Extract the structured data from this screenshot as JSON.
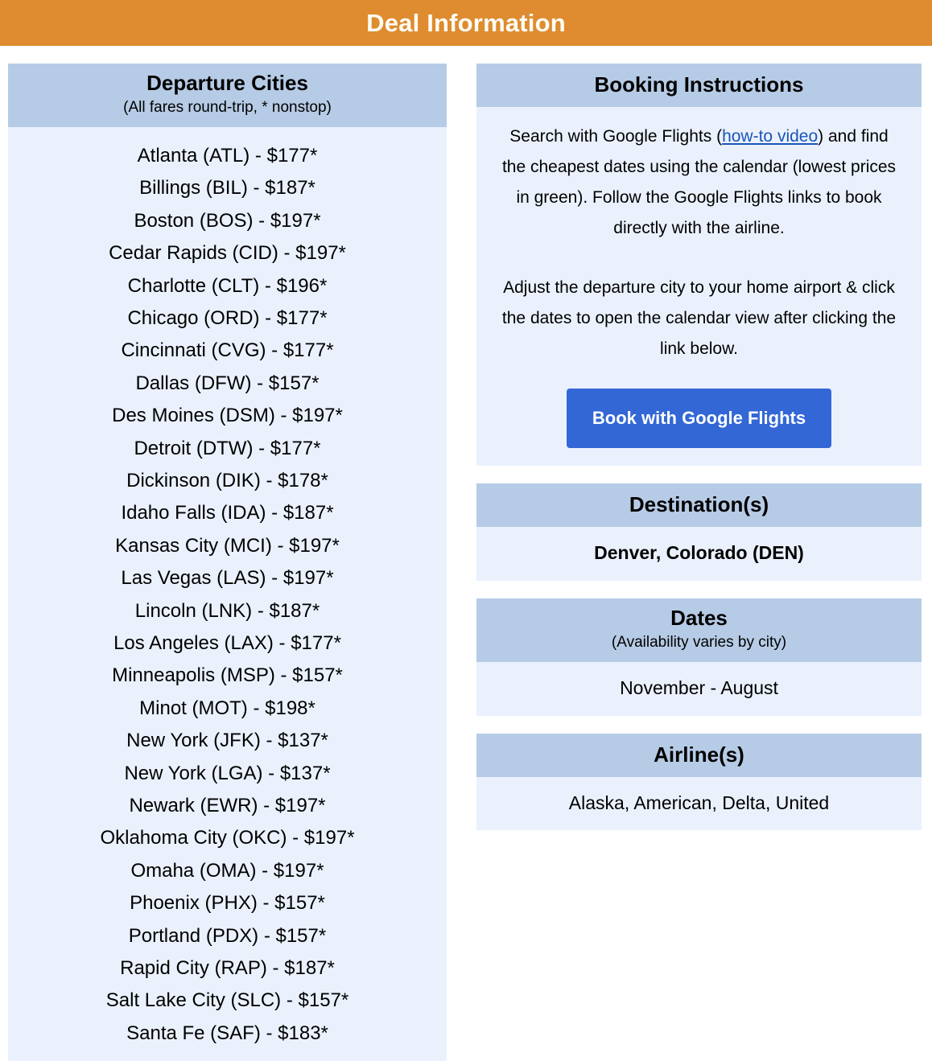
{
  "banner": {
    "title": "Deal Information",
    "background_color": "#de8c2f",
    "text_color": "#fffdf6"
  },
  "theme": {
    "panel_header_bg": "#b6cbe5",
    "panel_body_bg": "#eaf1fd",
    "page_bg": "#ffffff",
    "link_color": "#1a55b8",
    "button_bg": "#3367d6",
    "button_text_color": "#ffffff"
  },
  "departure_cities": {
    "title": "Departure Cities",
    "subtitle": "(All fares round-trip, * nonstop)",
    "rows": [
      "Atlanta (ATL) - $177*",
      "Billings (BIL) - $187*",
      "Boston (BOS) - $197*",
      "Cedar Rapids (CID) - $197*",
      "Charlotte (CLT) - $196*",
      "Chicago (ORD) - $177*",
      "Cincinnati (CVG) - $177*",
      "Dallas (DFW) - $157*",
      "Des Moines (DSM) - $197*",
      "Detroit (DTW) - $177*",
      "Dickinson (DIK) - $178*",
      "Idaho Falls (IDA) - $187*",
      "Kansas City (MCI) - $197*",
      "Las Vegas (LAS) - $197*",
      "Lincoln (LNK) - $187*",
      "Los Angeles (LAX) - $177*",
      "Minneapolis (MSP) - $157*",
      "Minot (MOT) - $198*",
      "New York (JFK) - $137*",
      "New York (LGA) - $137*",
      "Newark (EWR) - $197*",
      "Oklahoma City (OKC) - $197*",
      "Omaha (OMA) - $197*",
      "Phoenix (PHX) - $157*",
      "Portland (PDX) - $157*",
      "Rapid City (RAP) - $187*",
      "Salt Lake City (SLC) - $157*",
      "Santa Fe (SAF) - $183*"
    ]
  },
  "booking_instructions": {
    "title": "Booking Instructions",
    "paragraph1_before_link": "Search with Google Flights (",
    "link_text": "how-to video",
    "paragraph1_after_link": ") and find the cheapest dates using the calendar (lowest prices in green). Follow the Google Flights links to book directly with the airline.",
    "paragraph2": "Adjust the departure city to your home airport & click the dates to open the calendar view after clicking the link below.",
    "button_label": "Book with Google Flights"
  },
  "destinations": {
    "title": "Destination(s)",
    "value": "Denver, Colorado (DEN)"
  },
  "dates": {
    "title": "Dates",
    "subtitle": "(Availability varies by city)",
    "value": "November - August"
  },
  "airlines": {
    "title": "Airline(s)",
    "value": "Alaska, American, Delta, United"
  }
}
